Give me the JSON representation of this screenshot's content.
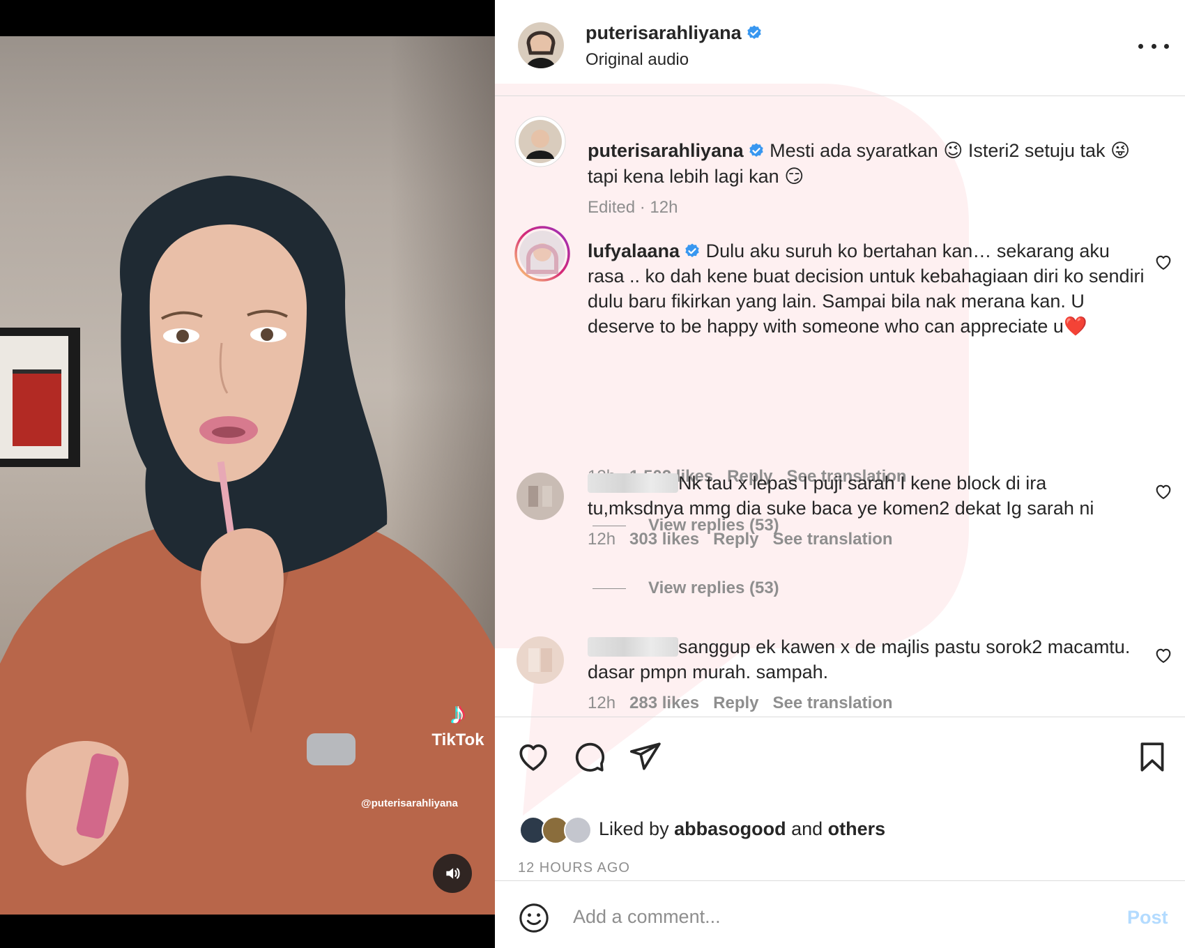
{
  "post": {
    "username": "puterisarahliyana",
    "subtitle": "Original audio",
    "more_icon": "more-horizontal-icon"
  },
  "video": {
    "tiktok_brand": "TikTok",
    "tiktok_handle": "@puterisarahliyana",
    "sound_icon": "volume-icon"
  },
  "caption": {
    "username": "puterisarahliyana",
    "text_1": "Mesti ada syaratkan ",
    "emoji_1": "😉",
    "text_2": " Isteri2 setuju tak ",
    "emoji_2": "😜",
    "text_3": " tapi kena lebih lagi kan ",
    "emoji_3": "😏",
    "meta": "Edited · 12h"
  },
  "comments": [
    {
      "username": "lufyalaana",
      "text": "Dulu aku suruh ko bertahan kan… sekarang aku rasa .. ko dah kene buat decision untuk kebahagiaan diri ko sendiri dulu baru fikirkan yang lain. Sampai bila nak merana kan. U deserve to be happy with someone who can appreciate u",
      "emoji": "❤️",
      "time": "12h",
      "likes": "1,502 likes",
      "reply": "Reply",
      "translate": "See translation",
      "view_replies": "View replies (53)"
    },
    {
      "username": "",
      "text": "Nk tau x lepas I puji sarah I kene block di ira tu,mksdnya mmg dia suke baca ye komen2 dekat Ig sarah ni",
      "time": "12h",
      "likes": "303 likes",
      "reply": "Reply",
      "translate": "See translation",
      "view_replies": "View replies (53)"
    },
    {
      "username": "",
      "text": "sanggup ek kawen x de majlis pastu sorok2 macamtu. dasar pmpn murah. sampah.",
      "time": "12h",
      "likes": "283 likes",
      "reply": "Reply",
      "translate": "See translation"
    }
  ],
  "actions": {
    "like_icon": "heart-icon",
    "comment_icon": "comment-icon",
    "share_icon": "send-icon",
    "save_icon": "bookmark-icon"
  },
  "likes": {
    "prefix": "Liked by ",
    "user": "abbasogood",
    "middle": " and ",
    "others": "others",
    "time_ago": "12 HOURS AGO"
  },
  "add_comment": {
    "placeholder": "Add a comment...",
    "post_label": "Post",
    "emoji_icon": "smiley-icon"
  },
  "colors": {
    "verified_blue": "#3897f0",
    "muted_text": "#8e8e8e",
    "post_disabled": "#b3dbff",
    "divider": "#dbdbdb"
  }
}
